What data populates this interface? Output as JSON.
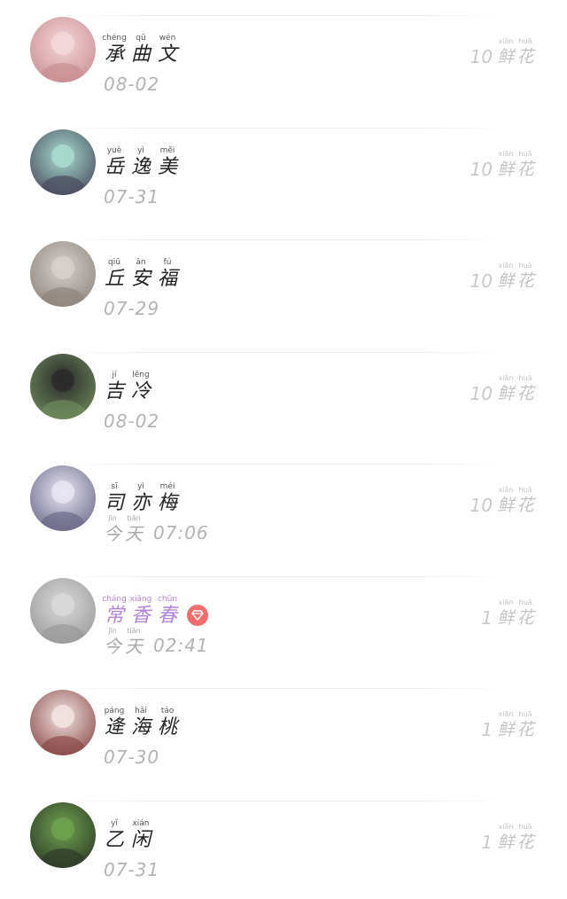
{
  "entries": [
    {
      "name": [
        {
          "py": "chéng",
          "hz": "承"
        },
        {
          "py": "qū",
          "hz": "曲"
        },
        {
          "py": "wén",
          "hz": "文"
        }
      ],
      "date": "08-02",
      "flowers": {
        "count": "10",
        "label": [
          {
            "py": "xiān",
            "hz": "鲜"
          },
          {
            "py": "huā",
            "hz": "花"
          }
        ]
      },
      "avatar_colors": [
        "#f3d7d9",
        "#c98e93"
      ]
    },
    {
      "name": [
        {
          "py": "yuè",
          "hz": "岳"
        },
        {
          "py": "yì",
          "hz": "逸"
        },
        {
          "py": "měi",
          "hz": "美"
        }
      ],
      "date": "07-31",
      "flowers": {
        "count": "10",
        "label": [
          {
            "py": "xiān",
            "hz": "鲜"
          },
          {
            "py": "huā",
            "hz": "花"
          }
        ]
      },
      "avatar_colors": [
        "#a8dccf",
        "#4a4a5c"
      ]
    },
    {
      "name": [
        {
          "py": "qiū",
          "hz": "丘"
        },
        {
          "py": "ān",
          "hz": "安"
        },
        {
          "py": "fú",
          "hz": "福"
        }
      ],
      "date": "07-29",
      "flowers": {
        "count": "10",
        "label": [
          {
            "py": "xiān",
            "hz": "鲜"
          },
          {
            "py": "huā",
            "hz": "花"
          }
        ]
      },
      "avatar_colors": [
        "#d7d1cc",
        "#8d847d"
      ]
    },
    {
      "name": [
        {
          "py": "jí",
          "hz": "吉"
        },
        {
          "py": "lěng",
          "hz": "冷"
        }
      ],
      "date": "08-02",
      "flowers": {
        "count": "10",
        "label": [
          {
            "py": "xiān",
            "hz": "鲜"
          },
          {
            "py": "huā",
            "hz": "花"
          }
        ]
      },
      "avatar_colors": [
        "#2a2a2a",
        "#6f8a5e"
      ]
    },
    {
      "name": [
        {
          "py": "sī",
          "hz": "司"
        },
        {
          "py": "yì",
          "hz": "亦"
        },
        {
          "py": "méi",
          "hz": "梅"
        }
      ],
      "date_prefix": [
        {
          "py": "jīn",
          "hz": "今"
        },
        {
          "py": "tiān",
          "hz": "天"
        }
      ],
      "date": "07:06",
      "flowers": {
        "count": "10",
        "label": [
          {
            "py": "xiān",
            "hz": "鲜"
          },
          {
            "py": "huā",
            "hz": "花"
          }
        ]
      },
      "avatar_colors": [
        "#e8e6f2",
        "#6c6a88"
      ]
    },
    {
      "name": [
        {
          "py": "cháng",
          "hz": "常"
        },
        {
          "py": "xiāng",
          "hz": "香"
        },
        {
          "py": "chūn",
          "hz": "春"
        }
      ],
      "vip": true,
      "date_prefix": [
        {
          "py": "jīn",
          "hz": "今"
        },
        {
          "py": "tiān",
          "hz": "天"
        }
      ],
      "date": "02:41",
      "flowers": {
        "count": "1",
        "label": [
          {
            "py": "xiān",
            "hz": "鲜"
          },
          {
            "py": "huā",
            "hz": "花"
          }
        ]
      },
      "avatar_colors": [
        "#d9d9d9",
        "#9a9a9a"
      ]
    },
    {
      "name": [
        {
          "py": "páng",
          "hz": "逄"
        },
        {
          "py": "hǎi",
          "hz": "海"
        },
        {
          "py": "táo",
          "hz": "桃"
        }
      ],
      "date": "07-30",
      "flowers": {
        "count": "1",
        "label": [
          {
            "py": "xiān",
            "hz": "鲜"
          },
          {
            "py": "huā",
            "hz": "花"
          }
        ]
      },
      "avatar_colors": [
        "#f1e4e2",
        "#8b4a4a"
      ]
    },
    {
      "name": [
        {
          "py": "yǐ",
          "hz": "乙"
        },
        {
          "py": "xián",
          "hz": "闲"
        }
      ],
      "date": "07-31",
      "flowers": {
        "count": "1",
        "label": [
          {
            "py": "xiān",
            "hz": "鲜"
          },
          {
            "py": "huā",
            "hz": "花"
          }
        ]
      },
      "avatar_colors": [
        "#6fa24d",
        "#2f3a2a"
      ]
    }
  ],
  "colors": {
    "vip_name": "#b184d6",
    "vip_badge": "#ef6d6d",
    "date_text": "#b3b3b3",
    "flower_text": "#c9c9c9"
  }
}
